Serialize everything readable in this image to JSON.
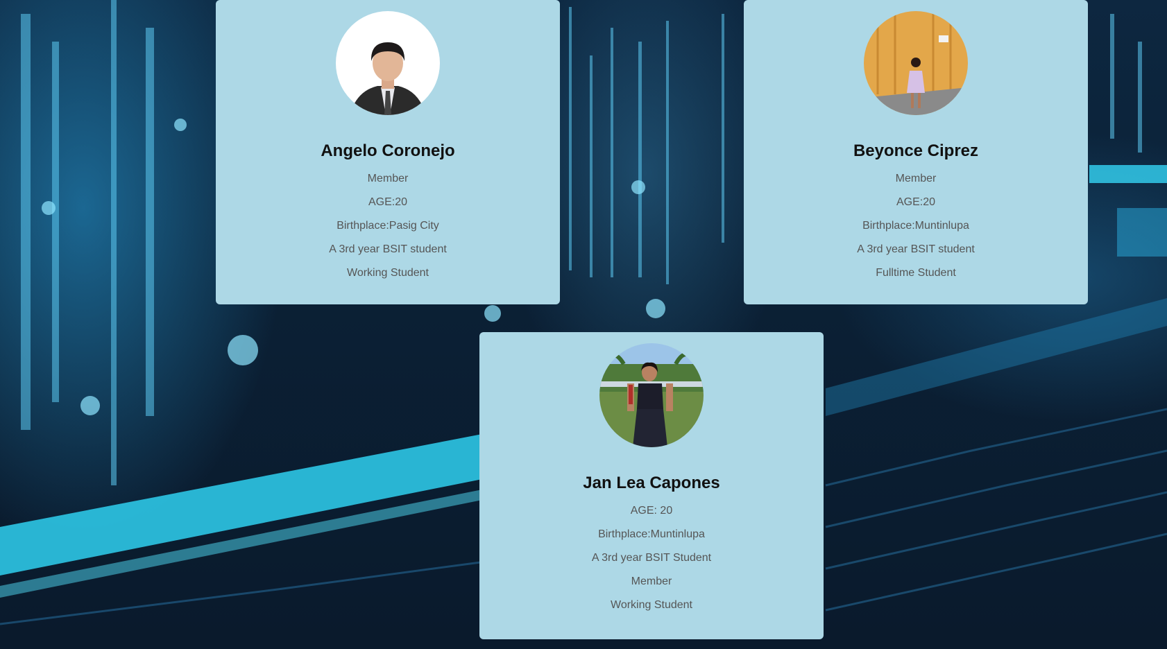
{
  "members": [
    {
      "name": "Angelo Coronejo",
      "lines": [
        "Member",
        "AGE:20",
        "Birthplace:Pasig City",
        "A 3rd year BSIT student",
        "Working Student"
      ]
    },
    {
      "name": "Beyonce Ciprez",
      "lines": [
        "Member",
        "AGE:20",
        "Birthplace:Muntinlupa",
        "A 3rd year BSIT student",
        "Fulltime Student"
      ]
    },
    {
      "name": "Jan Lea Capones",
      "lines": [
        "AGE: 20",
        "Birthplace:Muntinlupa",
        "A 3rd year BSIT Student",
        "Member",
        "Working Student"
      ]
    }
  ],
  "colors": {
    "card_background": "#add8e6",
    "name_text": "#111111",
    "info_text": "#555555",
    "page_background": "#0a1a2c"
  }
}
